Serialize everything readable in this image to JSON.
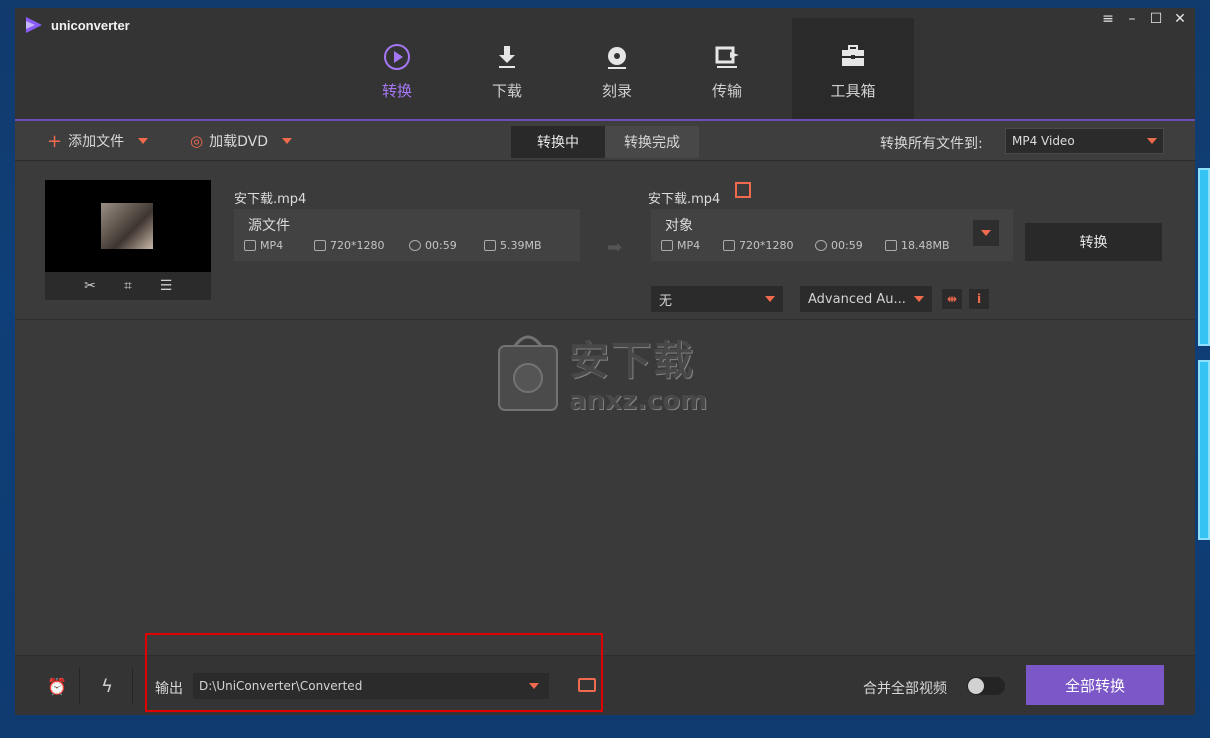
{
  "app": {
    "name": "uniconverter"
  },
  "window_controls": [
    "≡",
    "–",
    "☐",
    "✕"
  ],
  "nav": {
    "tabs": [
      {
        "label": "转换",
        "icon": "play-circle-icon",
        "active": true
      },
      {
        "label": "下载",
        "icon": "download-icon",
        "active": false
      },
      {
        "label": "刻录",
        "icon": "disc-burn-icon",
        "active": false
      },
      {
        "label": "传输",
        "icon": "transfer-icon",
        "active": false
      },
      {
        "label": "工具箱",
        "icon": "toolbox-icon",
        "active": false
      }
    ]
  },
  "toolbar": {
    "add_files": "添加文件",
    "load_dvd": "加载DVD",
    "tab_converting": "转换中",
    "tab_converted": "转换完成",
    "convert_all_to_label": "转换所有文件到:",
    "format_value": "MP4 Video"
  },
  "file": {
    "source_name": "安下载.mp4",
    "target_name": "安下载.mp4",
    "source": {
      "title": "源文件",
      "format": "MP4",
      "resolution": "720*1280",
      "duration": "00:59",
      "size": "5.39MB"
    },
    "target": {
      "title": "对象",
      "format": "MP4",
      "resolution": "720*1280",
      "duration": "00:59",
      "size": "18.48MB"
    },
    "convert_button": "转换",
    "subtitle_select": "无",
    "audio_select": "Advanced Au..."
  },
  "watermark": {
    "cn": "安下载",
    "en": "anxz.com"
  },
  "bottom": {
    "output_label": "输出",
    "output_path": "D:\\UniConverter\\Converted",
    "merge_label": "合并全部视频",
    "merge_enabled": false,
    "convert_all_button": "全部转换"
  },
  "colors": {
    "accent_purple": "#7b57c7",
    "accent_orange": "#f06a4d",
    "highlight_red": "#e00000"
  }
}
